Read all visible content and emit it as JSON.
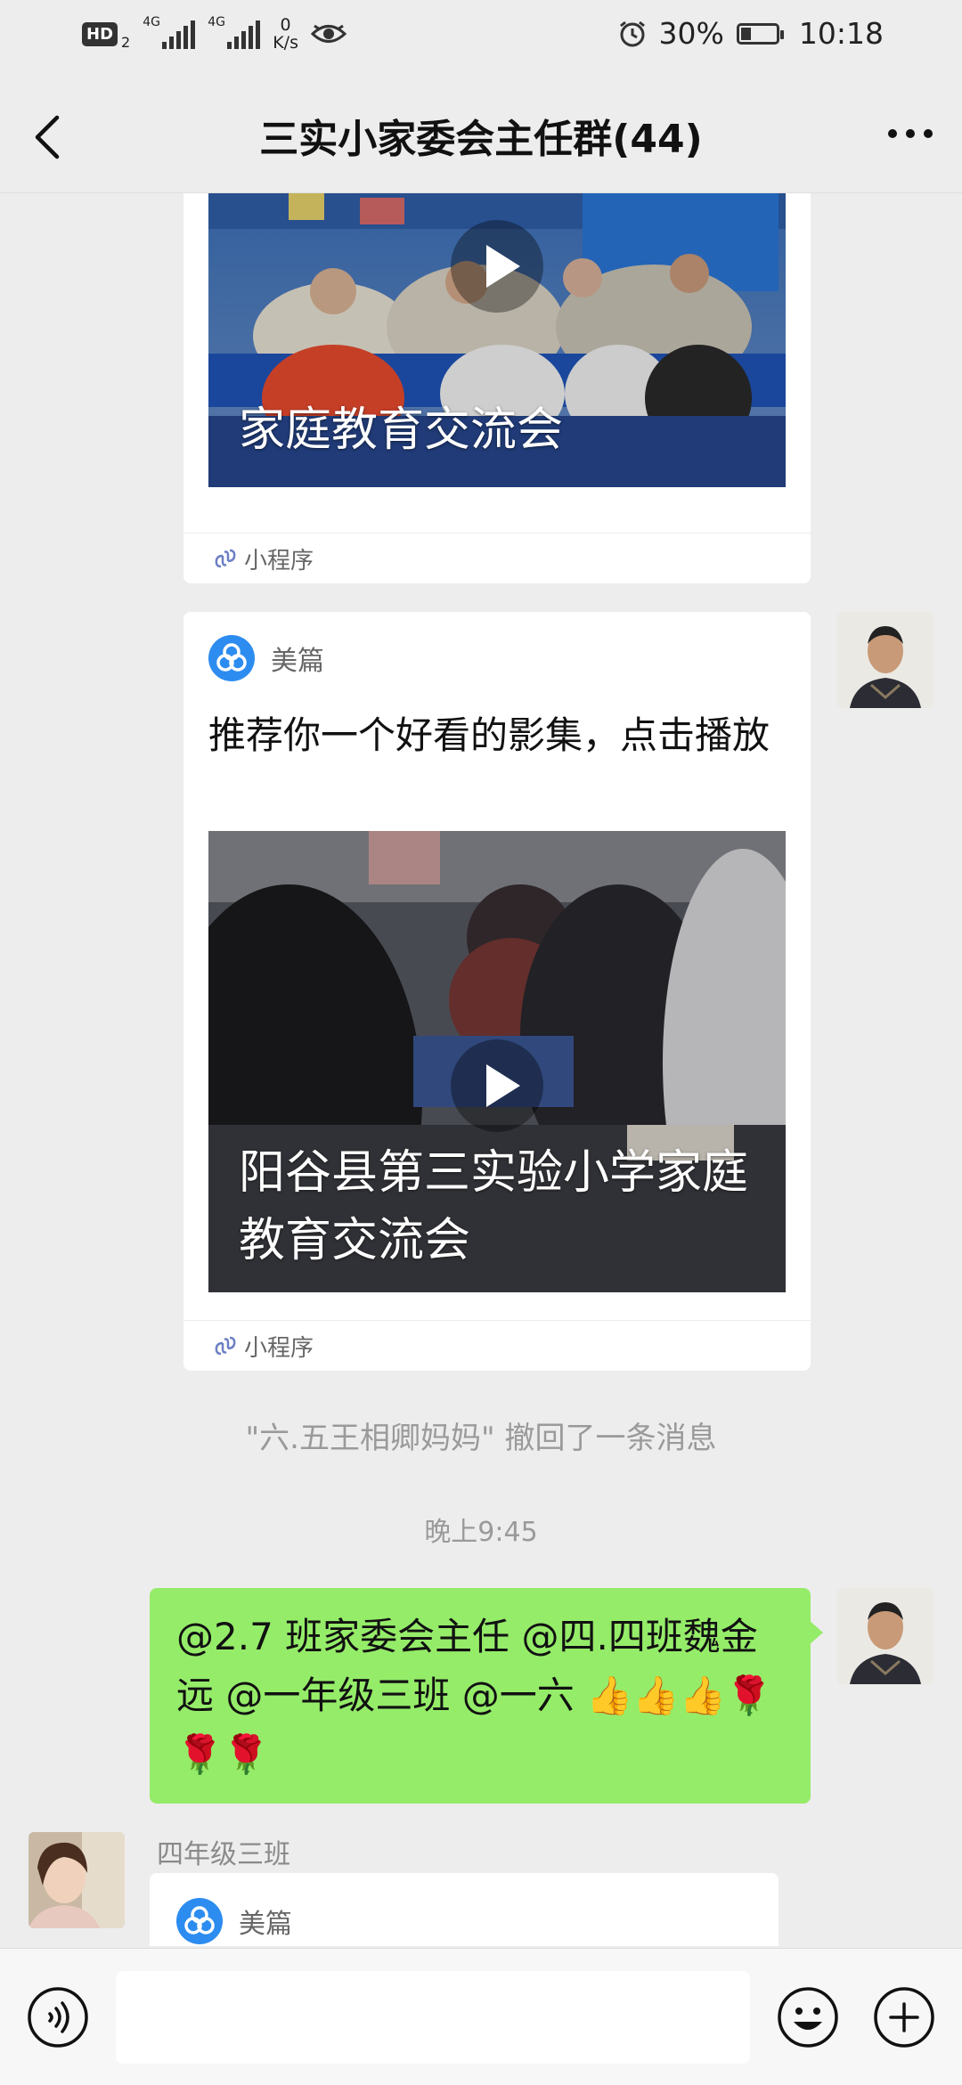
{
  "status_bar": {
    "hd": "HD",
    "hd_sub": "2",
    "net1": "4G",
    "net2": "4G",
    "speed_value": "0",
    "speed_unit": "K/s",
    "battery": "30%",
    "battery_level": 0.3,
    "time": "10:18"
  },
  "nav": {
    "title": "三实小家委会主任群(44)"
  },
  "messages": {
    "card1": {
      "video_caption": "家庭教育交流会",
      "mini_label": "小程序"
    },
    "card2": {
      "source": "美篇",
      "title": "推荐你一个好看的影集，点击播放",
      "video_caption": "阳谷县第三实验小学家庭教育交流会",
      "mini_label": "小程序"
    },
    "recall_notice": "\"六.五王相卿妈妈\" 撤回了一条消息",
    "time_divider": "晚上9:45",
    "text_msg": "@2.7 班家委会主任  @四.四班魏金远  @一年级三班  @一六 👍👍👍🌹🌹🌹",
    "card3": {
      "sender": "四年级三班",
      "source": "美篇"
    }
  },
  "input": {
    "placeholder": ""
  }
}
